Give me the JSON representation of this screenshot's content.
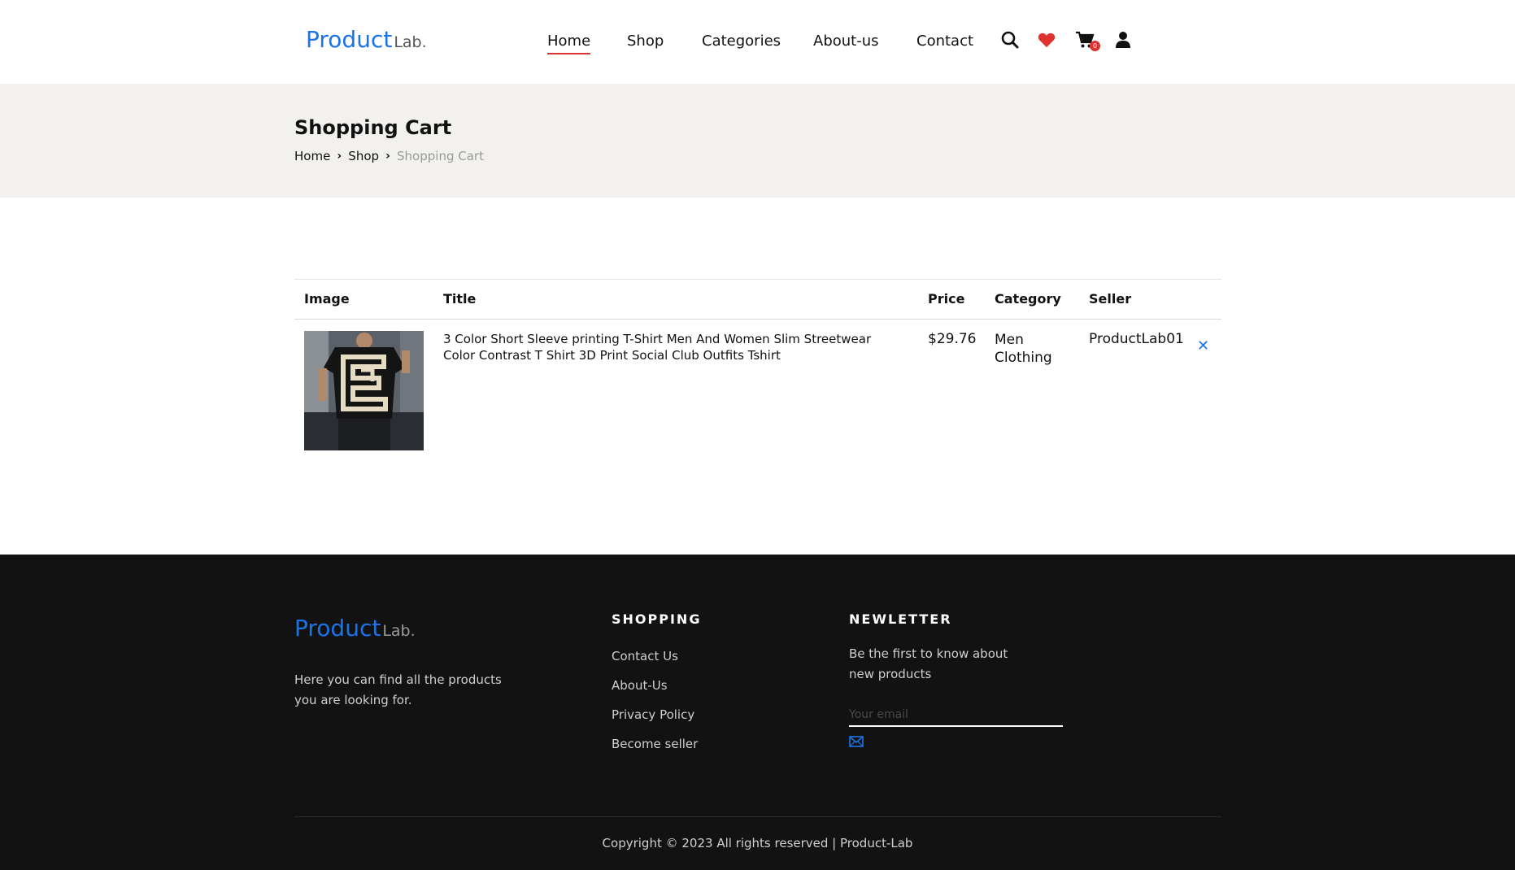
{
  "header": {
    "logo_main": "Product",
    "logo_sub": "Lab.",
    "nav": [
      "Home",
      "Shop",
      "Categories",
      "About-us",
      "Contact"
    ],
    "active_nav": "Home",
    "cart_count": "0",
    "icons": [
      "search-icon",
      "heart-icon",
      "cart-icon",
      "user-icon"
    ],
    "accent_color": "#1a73e8",
    "active_color": "#e03131"
  },
  "banner": {
    "title": "Shopping Cart",
    "breadcrumb": [
      "Home",
      "Shop",
      "Shopping Cart"
    ]
  },
  "cart": {
    "columns": [
      "Image",
      "Title",
      "Price",
      "Category",
      "Seller"
    ],
    "items": [
      {
        "title": "3 Color Short Sleeve printing T-Shirt Men And Women Slim Streetwear Color Contrast T Shirt 3D Print Social Club Outfits Tshirt",
        "price": "$29.76",
        "category": "Men Clothing",
        "seller": "ProductLab01",
        "remove_icon": "close-icon"
      }
    ]
  },
  "footer": {
    "logo_main": "Product",
    "logo_sub": "Lab.",
    "description": "Here you can find all the products you are looking for.",
    "shopping_title": "SHOPPING",
    "shopping_links": [
      "Contact Us",
      "About-Us",
      "Privacy Policy",
      "Become seller"
    ],
    "newsletter_title": "NEWLETTER",
    "newsletter_text": "Be the first to know about new products",
    "email_placeholder": "Your email",
    "copyright": "Copyright © 2023 All rights reserved | Product-Lab"
  }
}
